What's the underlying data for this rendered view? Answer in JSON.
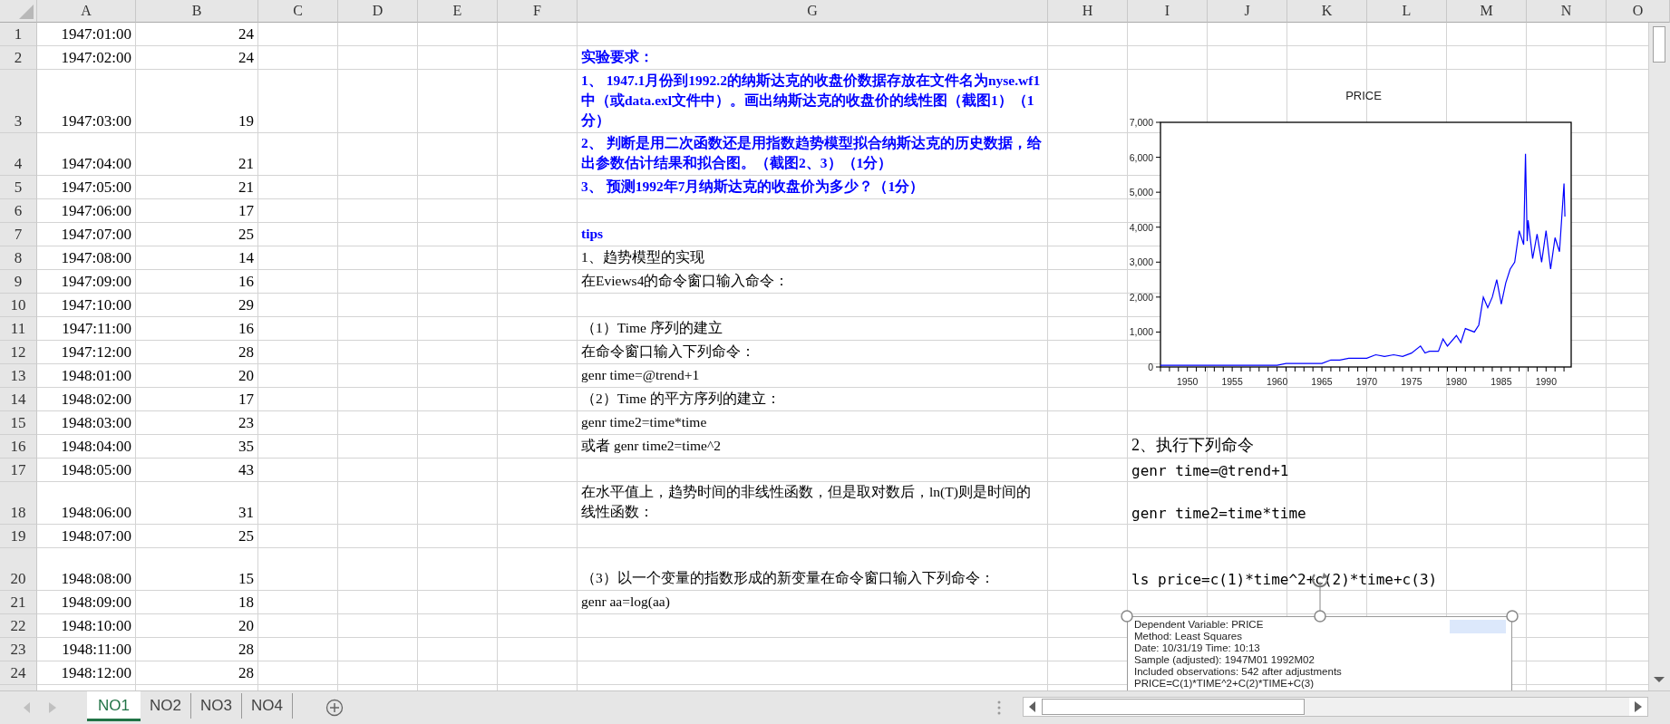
{
  "columns": [
    "A",
    "B",
    "C",
    "D",
    "E",
    "F",
    "G",
    "H",
    "I",
    "J",
    "K",
    "L",
    "M",
    "N",
    "O"
  ],
  "rows": [
    {
      "number": "1",
      "date": "1947:01:00",
      "value": "24"
    },
    {
      "number": "2",
      "date": "1947:02:00",
      "value": "24",
      "note": {
        "kind": "heading",
        "text": "实验要求："
      }
    },
    {
      "number": "3",
      "date": "1947:03:00",
      "value": "19",
      "note": {
        "kind": "heading",
        "text": "1、 1947.1月份到1992.2的纳斯达克的收盘价数据存放在文件名为nyse.wf1中（或data.exl文件中）。画出纳斯达克的收盘价的线性图（截图1）（1分）"
      }
    },
    {
      "number": "4",
      "date": "1947:04:00",
      "value": "21",
      "note": {
        "kind": "heading",
        "text": "2、 判断是用二次函数还是用指数趋势模型拟合纳斯达克的历史数据，给出参数估计结果和拟合图。（截图2、3）（1分）"
      }
    },
    {
      "number": "5",
      "date": "1947:05:00",
      "value": "21",
      "note": {
        "kind": "heading",
        "text": "3、 预测1992年7月纳斯达克的收盘价为多少？（1分）"
      }
    },
    {
      "number": "6",
      "date": "1947:06:00",
      "value": "17"
    },
    {
      "number": "7",
      "date": "1947:07:00",
      "value": "25",
      "note": {
        "kind": "heading",
        "text": "tips"
      }
    },
    {
      "number": "8",
      "date": "1947:08:00",
      "value": "14",
      "note": {
        "kind": "body",
        "text": "1、趋势模型的实现"
      }
    },
    {
      "number": "9",
      "date": "1947:09:00",
      "value": "16",
      "note": {
        "kind": "body",
        "text": "在Eviews4的命令窗口输入命令："
      }
    },
    {
      "number": "10",
      "date": "1947:10:00",
      "value": "29"
    },
    {
      "number": "11",
      "date": "1947:11:00",
      "value": "16",
      "note": {
        "kind": "body",
        "text": "（1）Time 序列的建立"
      }
    },
    {
      "number": "12",
      "date": "1947:12:00",
      "value": "28",
      "note": {
        "kind": "body",
        "text": "在命令窗口输入下列命令："
      }
    },
    {
      "number": "13",
      "date": "1948:01:00",
      "value": "20",
      "note": {
        "kind": "body",
        "text": "genr time=@trend+1"
      }
    },
    {
      "number": "14",
      "date": "1948:02:00",
      "value": "17",
      "note": {
        "kind": "body",
        "text": "（2）Time 的平方序列的建立："
      }
    },
    {
      "number": "15",
      "date": "1948:03:00",
      "value": "23",
      "note": {
        "kind": "body",
        "text": "genr time2=time*time"
      }
    },
    {
      "number": "16",
      "date": "1948:04:00",
      "value": "35",
      "note": {
        "kind": "body",
        "text": "或者  genr time2=time^2"
      },
      "side": {
        "kind": "body",
        "text": "2、执行下列命令"
      }
    },
    {
      "number": "17",
      "date": "1948:05:00",
      "value": "43",
      "side": {
        "kind": "code",
        "text": "genr time=@trend+1"
      }
    },
    {
      "number": "18",
      "date": "1948:06:00",
      "value": "31",
      "note": {
        "kind": "body",
        "text": "在水平值上，趋势时间的非线性函数，但是取对数后，ln(T)则是时间的线性函数："
      },
      "side": {
        "kind": "code",
        "text": "genr time2=time*time"
      }
    },
    {
      "number": "19",
      "date": "1948:07:00",
      "value": "25"
    },
    {
      "number": "20",
      "date": "1948:08:00",
      "value": "15",
      "note": {
        "kind": "body",
        "text": "（3）以一个变量的指数形成的新变量在命令窗口输入下列命令："
      },
      "side": {
        "kind": "code",
        "text": "ls price=c(1)*time^2+c(2)*time+c(3)"
      }
    },
    {
      "number": "21",
      "date": "1948:09:00",
      "value": "18",
      "note": {
        "kind": "body",
        "text": "genr aa=log(aa)"
      }
    },
    {
      "number": "22",
      "date": "1948:10:00",
      "value": "20"
    },
    {
      "number": "23",
      "date": "1948:11:00",
      "value": "28"
    },
    {
      "number": "24",
      "date": "1948:12:00",
      "value": "28"
    }
  ],
  "chart": {
    "chart_data": {
      "type": "line",
      "title": "PRICE",
      "xlim": [
        1947,
        1992.8
      ],
      "ylim": [
        0,
        7000
      ],
      "xticks": [
        1950,
        1955,
        1960,
        1965,
        1970,
        1975,
        1980,
        1985,
        1990
      ],
      "yticks": [
        {
          "value": 0,
          "label": "0"
        },
        {
          "value": 1000,
          "label": "1,000"
        },
        {
          "value": 2000,
          "label": "2,000"
        },
        {
          "value": 3000,
          "label": "3,000"
        },
        {
          "value": 4000,
          "label": "4,000"
        },
        {
          "value": 5000,
          "label": "5,000"
        },
        {
          "value": 6000,
          "label": "6,000"
        },
        {
          "value": 7000,
          "label": "7,000"
        }
      ],
      "x": [
        1947,
        1948,
        1949,
        1950,
        1950.5,
        1951,
        1952,
        1953,
        1954,
        1955,
        1956,
        1957,
        1958,
        1959,
        1960,
        1961,
        1962,
        1963,
        1964,
        1965,
        1966,
        1967,
        1968,
        1969,
        1970,
        1971,
        1972,
        1973,
        1974,
        1975,
        1976,
        1976.5,
        1977,
        1978,
        1978.5,
        1979,
        1980,
        1980.5,
        1981,
        1982,
        1982.5,
        1983,
        1983.5,
        1984,
        1984.5,
        1985,
        1985.5,
        1986,
        1986.5,
        1987,
        1987.5,
        1987.7,
        1987.9,
        1988,
        1988.5,
        1989,
        1989.5,
        1990,
        1990.5,
        1991,
        1991.5,
        1992,
        1992.1
      ],
      "series": [
        {
          "color": "#0000ff",
          "values": [
            50,
            50,
            50,
            50,
            50,
            50,
            50,
            50,
            50,
            50,
            50,
            50,
            50,
            50,
            50,
            100,
            100,
            100,
            100,
            100,
            200,
            200,
            250,
            250,
            250,
            350,
            300,
            350,
            300,
            400,
            600,
            400,
            450,
            450,
            800,
            600,
            900,
            700,
            1100,
            1000,
            1200,
            2000,
            1700,
            2000,
            2500,
            1800,
            2400,
            2800,
            3000,
            3900,
            3500,
            6100,
            3600,
            4200,
            3100,
            3800,
            3000,
            3900,
            2800,
            3700,
            3300,
            5250,
            4300
          ]
        }
      ]
    }
  },
  "output_box": {
    "lines": [
      "Dependent Variable: PRICE",
      "Method: Least Squares",
      "Date: 10/31/19   Time: 10:13",
      "Sample (adjusted): 1947M01 1992M02",
      "Included observations: 542 after adjustments",
      "PRICE=C(1)*TIME^2+C(2)*TIME+C(3)"
    ]
  },
  "tabs": [
    {
      "label": "NO1",
      "selected": true
    },
    {
      "label": "NO2",
      "selected": false
    },
    {
      "label": "NO3",
      "selected": false
    },
    {
      "label": "NO4",
      "selected": false
    }
  ]
}
